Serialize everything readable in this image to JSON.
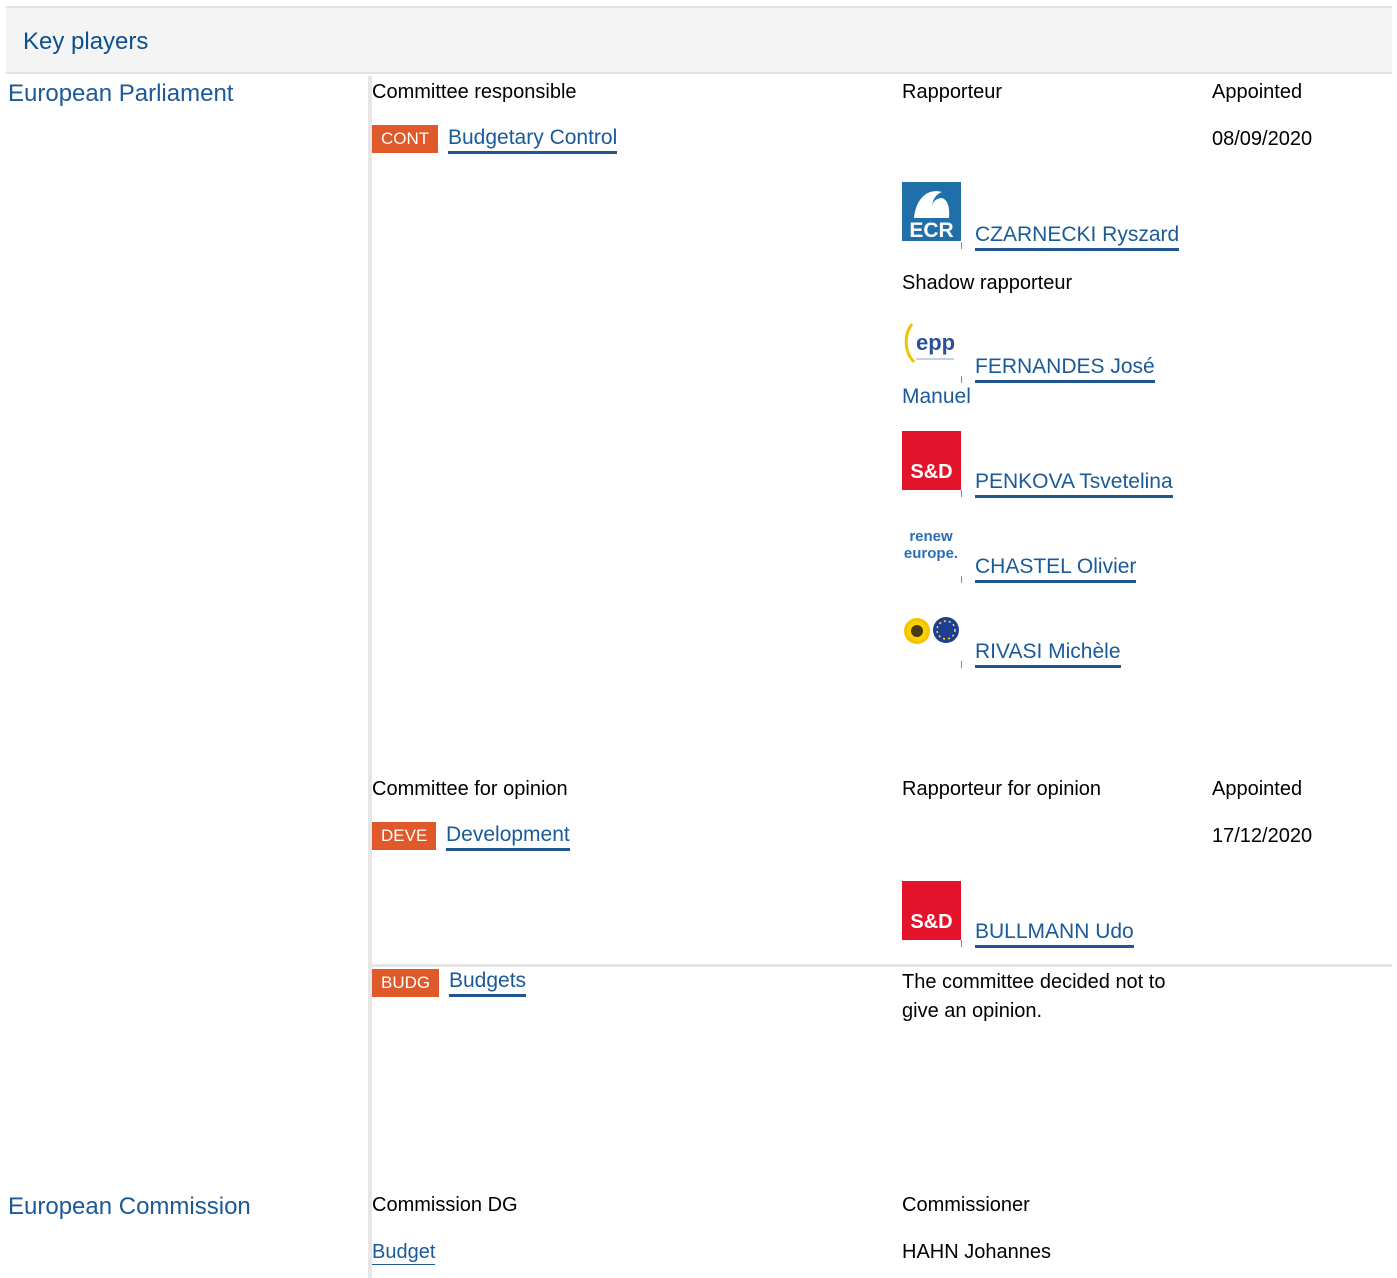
{
  "header": {
    "title": "Key players"
  },
  "parliament": {
    "name": "European Parliament",
    "responsible": {
      "col_committee": "Committee responsible",
      "col_rapporteur": "Rapporteur",
      "col_appointed": "Appointed",
      "committee_code": "CONT",
      "committee_name": "Budgetary Control",
      "appointed_date": "08/09/2020",
      "rapporteur": {
        "name": "CZARNECKI Ryszard",
        "group_logo": "ECR"
      },
      "shadow_label": "Shadow rapporteur",
      "shadows": [
        {
          "name_line1": "FERNANDES José",
          "name_line2": "Manuel",
          "group_logo": "epp"
        },
        {
          "name": "PENKOVA Tsvetelina",
          "group_logo": "S&D"
        },
        {
          "name": "CHASTEL Olivier",
          "group_logo_line1": "renew",
          "group_logo_line2": "europe."
        },
        {
          "name": "RIVASI Michèle",
          "group_logo": "greens-efa-icon"
        }
      ]
    },
    "opinion": {
      "col_committee": "Committee for opinion",
      "col_rapporteur": "Rapporteur for opinion",
      "col_appointed": "Appointed",
      "committees": [
        {
          "code": "DEVE",
          "name": "Development",
          "appointed_date": "17/12/2020",
          "rapporteur": {
            "name": "BULLMANN Udo",
            "group_logo": "S&D"
          }
        },
        {
          "code": "BUDG",
          "name": "Budgets",
          "note_line1": "The committee decided not to",
          "note_line2": "give an opinion."
        }
      ]
    }
  },
  "commission": {
    "name": "European Commission",
    "col_dg": "Commission DG",
    "col_commissioner": "Commissioner",
    "dg_name": "Budget",
    "commissioner": "HAHN Johannes"
  },
  "colors": {
    "badge": "#e0592a",
    "link": "#1a5a99",
    "ecr": "#1f6fa8",
    "sd": "#e3132b",
    "renew": "#2a6fb5",
    "epp": "#2c4f9a"
  }
}
